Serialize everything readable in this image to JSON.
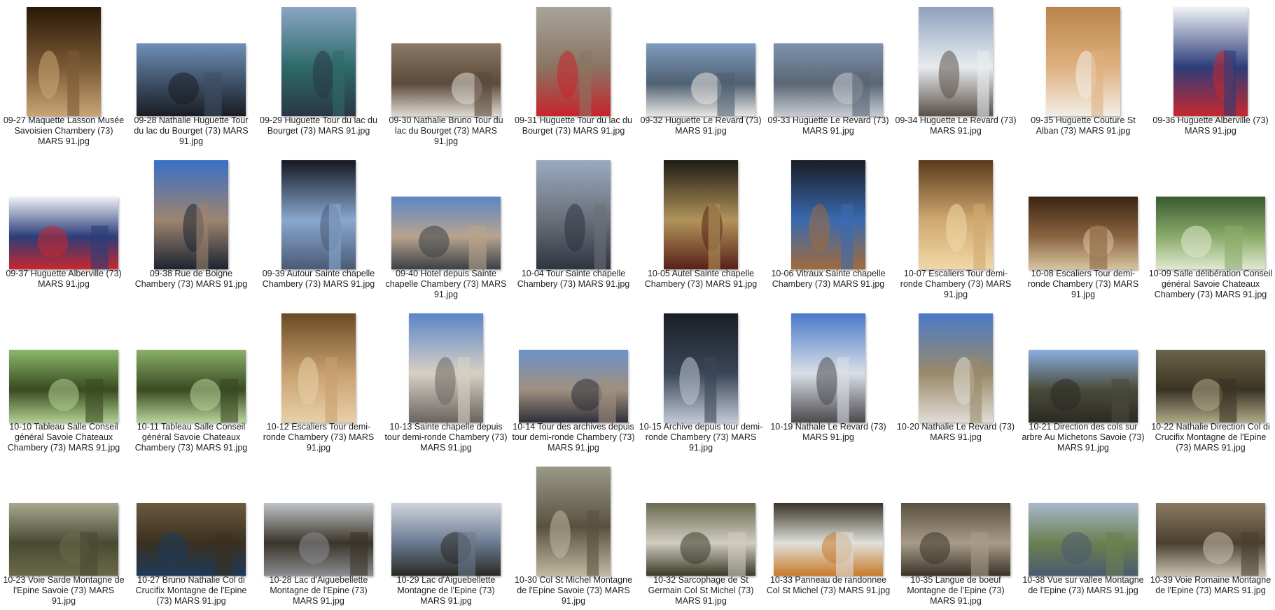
{
  "files": [
    {
      "name": "09-27 Maquette Lasson Musée Savoisien Chambery (73) MARS 91.jpg",
      "orientation": "portrait",
      "palette": [
        "#2a1808",
        "#7a5a34",
        "#c9a574"
      ]
    },
    {
      "name": "09-28 Nathalie Huguette Tour du lac du Bourget (73) MARS 91.jpg",
      "orientation": "landscape",
      "palette": [
        "#6f90b8",
        "#3d4f64",
        "#1a1d24"
      ]
    },
    {
      "name": "09-29 Huguette Tour du lac du Bourget (73) MARS 91.jpg",
      "orientation": "portrait",
      "palette": [
        "#8aa6c6",
        "#2e6a6a",
        "#2a3646"
      ]
    },
    {
      "name": "09-30 Nathalie Bruno Tour du lac du Bourget (73) MARS 91.jpg",
      "orientation": "landscape",
      "palette": [
        "#8a7966",
        "#5c4a3a",
        "#dedad2"
      ]
    },
    {
      "name": "09-31 Huguette Tour du lac du Bourget (73) MARS 91.jpg",
      "orientation": "portrait",
      "palette": [
        "#a8a49a",
        "#8a7462",
        "#c8242c"
      ]
    },
    {
      "name": "09-32 Huguette Le Revard (73) MARS 91.jpg",
      "orientation": "landscape",
      "palette": [
        "#7f9cc0",
        "#4f6072",
        "#e8e6e2"
      ]
    },
    {
      "name": "09-33 Huguette Le Revard (73) MARS 91.jpg",
      "orientation": "landscape",
      "palette": [
        "#7f92ae",
        "#5a6674",
        "#c8ccd2"
      ]
    },
    {
      "name": "09-34 Huguette Le Revard (73) MARS 91.jpg",
      "orientation": "portrait",
      "palette": [
        "#8ea2bc",
        "#e8ecf0",
        "#5a5048"
      ]
    },
    {
      "name": "09-35 Huguette Couture St Alban (73) MARS 91.jpg",
      "orientation": "portrait",
      "palette": [
        "#b8864a",
        "#e0b080",
        "#f2eee8"
      ]
    },
    {
      "name": "09-36 Huguette Alberville (73) MARS 91.jpg",
      "orientation": "portrait",
      "palette": [
        "#f0f2f6",
        "#2c3d7a",
        "#c8272e"
      ]
    },
    {
      "name": "09-37 Huguette Alberville (73) MARS 91.jpg",
      "orientation": "landscape",
      "palette": [
        "#f0f2f6",
        "#2c3d7a",
        "#c8272e"
      ]
    },
    {
      "name": "09-38 Rue de Boigne Chambery (73) MARS 91.jpg",
      "orientation": "portrait",
      "palette": [
        "#3a70c6",
        "#9c8470",
        "#1e2430"
      ]
    },
    {
      "name": "09-39 Autour Sainte chapelle Chambery (73) MARS 91.jpg",
      "orientation": "portrait",
      "palette": [
        "#141820",
        "#8aa8d0",
        "#4a5a76"
      ]
    },
    {
      "name": "09-40 Hotel depuis Sainte chapelle Chambery (73) MARS 91.jpg",
      "orientation": "landscape",
      "palette": [
        "#5c86c6",
        "#b8a48c",
        "#3a4048"
      ]
    },
    {
      "name": "10-04 Tour Sainte chapelle Chambery (73) MARS 91.jpg",
      "orientation": "portrait",
      "palette": [
        "#9aaac0",
        "#6a6e78",
        "#2e3440"
      ]
    },
    {
      "name": "10-05 Autel Sainte chapelle Chambery (73) MARS 91.jpg",
      "orientation": "portrait",
      "palette": [
        "#1e1a14",
        "#b0945a",
        "#5a2018"
      ]
    },
    {
      "name": "10-06 Vitraux Sainte chapelle Chambery (73) MARS 91.jpg",
      "orientation": "portrait",
      "palette": [
        "#1a1c24",
        "#3a6ab0",
        "#a06a3a"
      ]
    },
    {
      "name": "10-07 Escaliers Tour demi-ronde Chambery (73) MARS 91.jpg",
      "orientation": "portrait",
      "palette": [
        "#5a3a1a",
        "#d0a870",
        "#f0d8a8"
      ]
    },
    {
      "name": "10-08 Escaliers Tour demi-ronde Chambery (73) MARS 91.jpg",
      "orientation": "landscape",
      "palette": [
        "#3a2412",
        "#8a6440",
        "#d8c4a0"
      ]
    },
    {
      "name": "10-09 Salle délibération Conseil général Savoie Chateaux Chambery (73) MARS 91.jpg",
      "orientation": "landscape",
      "palette": [
        "#3a5a30",
        "#8aac6a",
        "#e0e8d0"
      ]
    },
    {
      "name": "10-10 Tableau Salle Conseil général Savoie Chateaux Chambery (73) MARS 91.jpg",
      "orientation": "landscape",
      "palette": [
        "#8ab86a",
        "#3a4a22",
        "#b0d090"
      ]
    },
    {
      "name": "10-11 Tableau Salle Conseil général Savoie Chateaux Chambery (73) MARS 91.jpg",
      "orientation": "landscape",
      "palette": [
        "#8ab06a",
        "#3a4a22",
        "#b8d49a"
      ]
    },
    {
      "name": "10-12 Escaliers Tour demi-ronde Chambery (73) MARS 91.jpg",
      "orientation": "portrait",
      "palette": [
        "#6a4a24",
        "#c8a070",
        "#e8d0a8"
      ]
    },
    {
      "name": "10-13 Sainte chapelle depuis tour demi-ronde Chambery (73) MARS 91.jpg",
      "orientation": "portrait",
      "palette": [
        "#5a86c8",
        "#d8d0c4",
        "#6a6460"
      ]
    },
    {
      "name": "10-14 Tour des archives depuis tour demi-ronde Chambery (73) MARS 91.jpg",
      "orientation": "landscape",
      "palette": [
        "#6a92c8",
        "#a09080",
        "#2e3038"
      ]
    },
    {
      "name": "10-15 Archive depuis tour demi-ronde Chambery (73) MARS 91.jpg",
      "orientation": "portrait",
      "palette": [
        "#1a1e26",
        "#3a4658",
        "#c0c8d4"
      ]
    },
    {
      "name": "10-19 Nathale Le Revard (73) MARS 91.jpg",
      "orientation": "portrait",
      "palette": [
        "#4a7ac8",
        "#dadee6",
        "#4a4a4e"
      ]
    },
    {
      "name": "10-20 Nathalie Le Revard (73) MARS 91.jpg",
      "orientation": "portrait",
      "palette": [
        "#4a7ac8",
        "#9a8a6a",
        "#e0dcd6"
      ]
    },
    {
      "name": "10-21 Direction des cols sur arbre Au Michetons Savoie (73) MARS 91.jpg",
      "orientation": "landscape",
      "palette": [
        "#8ab0e0",
        "#4a4a3a",
        "#2a2a24"
      ]
    },
    {
      "name": "10-22 Nathalie Direction Col di Crucifix Montagne de l'Epine (73) MARS 91.jpg",
      "orientation": "landscape",
      "palette": [
        "#6a6448",
        "#3a3424",
        "#b0a888"
      ]
    },
    {
      "name": "10-23 Voie Sarde Montagne de l'Epine Savoie (73) MARS 91.jpg",
      "orientation": "landscape",
      "palette": [
        "#a8a890",
        "#4a4a34",
        "#6a6a48"
      ]
    },
    {
      "name": "10-27 Bruno Nathalie Col di Crucifix Montagne de l'Epine (73) MARS 91.jpg",
      "orientation": "landscape",
      "palette": [
        "#6a5a40",
        "#3a3020",
        "#1e3a5a"
      ]
    },
    {
      "name": "10-28 Lac d'Aiguebellette Montagne de l'Epine (73) MARS 91.jpg",
      "orientation": "landscape",
      "palette": [
        "#c0c4c8",
        "#3a342a",
        "#8a8c90"
      ]
    },
    {
      "name": "10-29 Lac d'Aiguebellette Montagne de l'Epine (73) MARS 91.jpg",
      "orientation": "landscape",
      "palette": [
        "#d0d4dc",
        "#6a7a90",
        "#2a2a24"
      ]
    },
    {
      "name": "10-30 Col St Michel Montagne de l'Epine Savoie (73) MARS 91.jpg",
      "orientation": "portrait",
      "palette": [
        "#9a9a8a",
        "#5a5040",
        "#c0b8a0"
      ]
    },
    {
      "name": "10-32 Sarcophage de St Germain Col St Michel (73) MARS 91.jpg",
      "orientation": "landscape",
      "palette": [
        "#6a6a50",
        "#d0ccc0",
        "#3a3a28"
      ]
    },
    {
      "name": "10-33 Panneau de randonnee Col St Michel (73) MARS 91.jpg",
      "orientation": "landscape",
      "palette": [
        "#3a3428",
        "#e0e0dc",
        "#c87a2a"
      ]
    },
    {
      "name": "10-35 Langue de boeuf Montagne de l'Epine (73) MARS 91.jpg",
      "orientation": "landscape",
      "palette": [
        "#5a5040",
        "#a89c88",
        "#3a3428"
      ]
    },
    {
      "name": "10-38 Vue sur vallee Montagne de l'Epine (73) MARS 91.jpg",
      "orientation": "landscape",
      "palette": [
        "#a8b8cc",
        "#6a8050",
        "#4a5a70"
      ]
    },
    {
      "name": "10-39 Voie Romaine Montagne de l'Epine (73) MARS 91.jpg",
      "orientation": "landscape",
      "palette": [
        "#8a7a60",
        "#4a4030",
        "#c8c0b0"
      ]
    }
  ]
}
